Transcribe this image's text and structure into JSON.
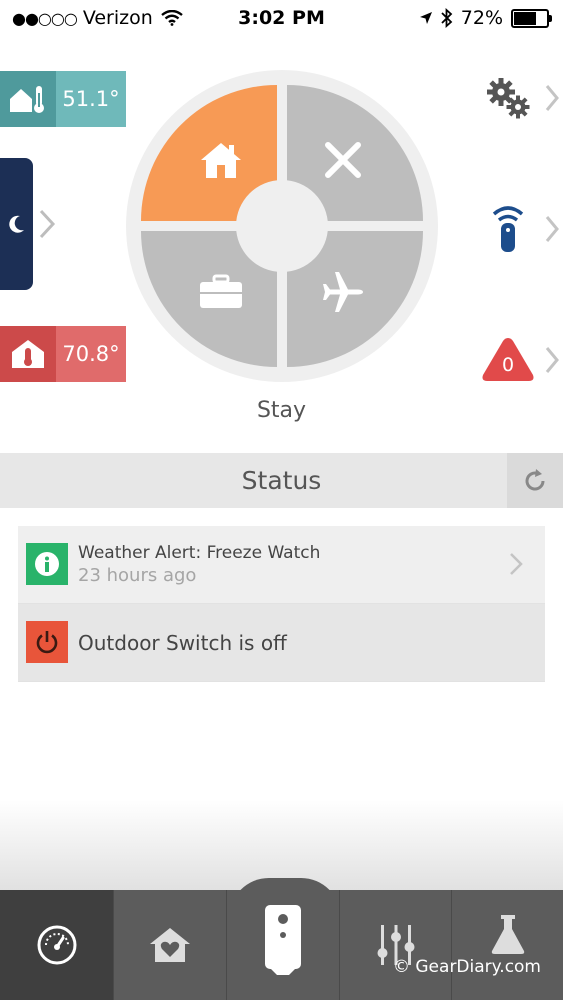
{
  "status_bar": {
    "signal_dots": "●●○○○",
    "carrier": "Verizon",
    "time": "3:02 PM",
    "battery": "72%",
    "battery_level": 0.72
  },
  "temps": {
    "outdoor": "51.1°",
    "indoor": "70.8°"
  },
  "mode": {
    "current": "Stay",
    "options": [
      "home",
      "off",
      "away",
      "vacation"
    ]
  },
  "alerts": {
    "count": "0"
  },
  "status": {
    "title": "Status",
    "items": [
      {
        "title": "Weather Alert: Freeze Watch",
        "subtitle": "23 hours ago",
        "icon": "info-icon"
      },
      {
        "title": "Outdoor Switch is off",
        "icon": "power-icon"
      }
    ]
  },
  "tabs": [
    "dashboard-icon",
    "home-heart-icon",
    "camera-icon",
    "sliders-icon",
    "lab-flask-icon"
  ],
  "watermark": "© GearDiary.com",
  "colors": {
    "home_mode": "#f79a55",
    "inactive_mode": "#bdbdbd",
    "outdoor": "#6fb9ba",
    "indoor": "#e06b6b",
    "info": "#29b36a",
    "power": "#e8553a",
    "remote": "#1d4d8c",
    "alert": "#e14a4a"
  }
}
